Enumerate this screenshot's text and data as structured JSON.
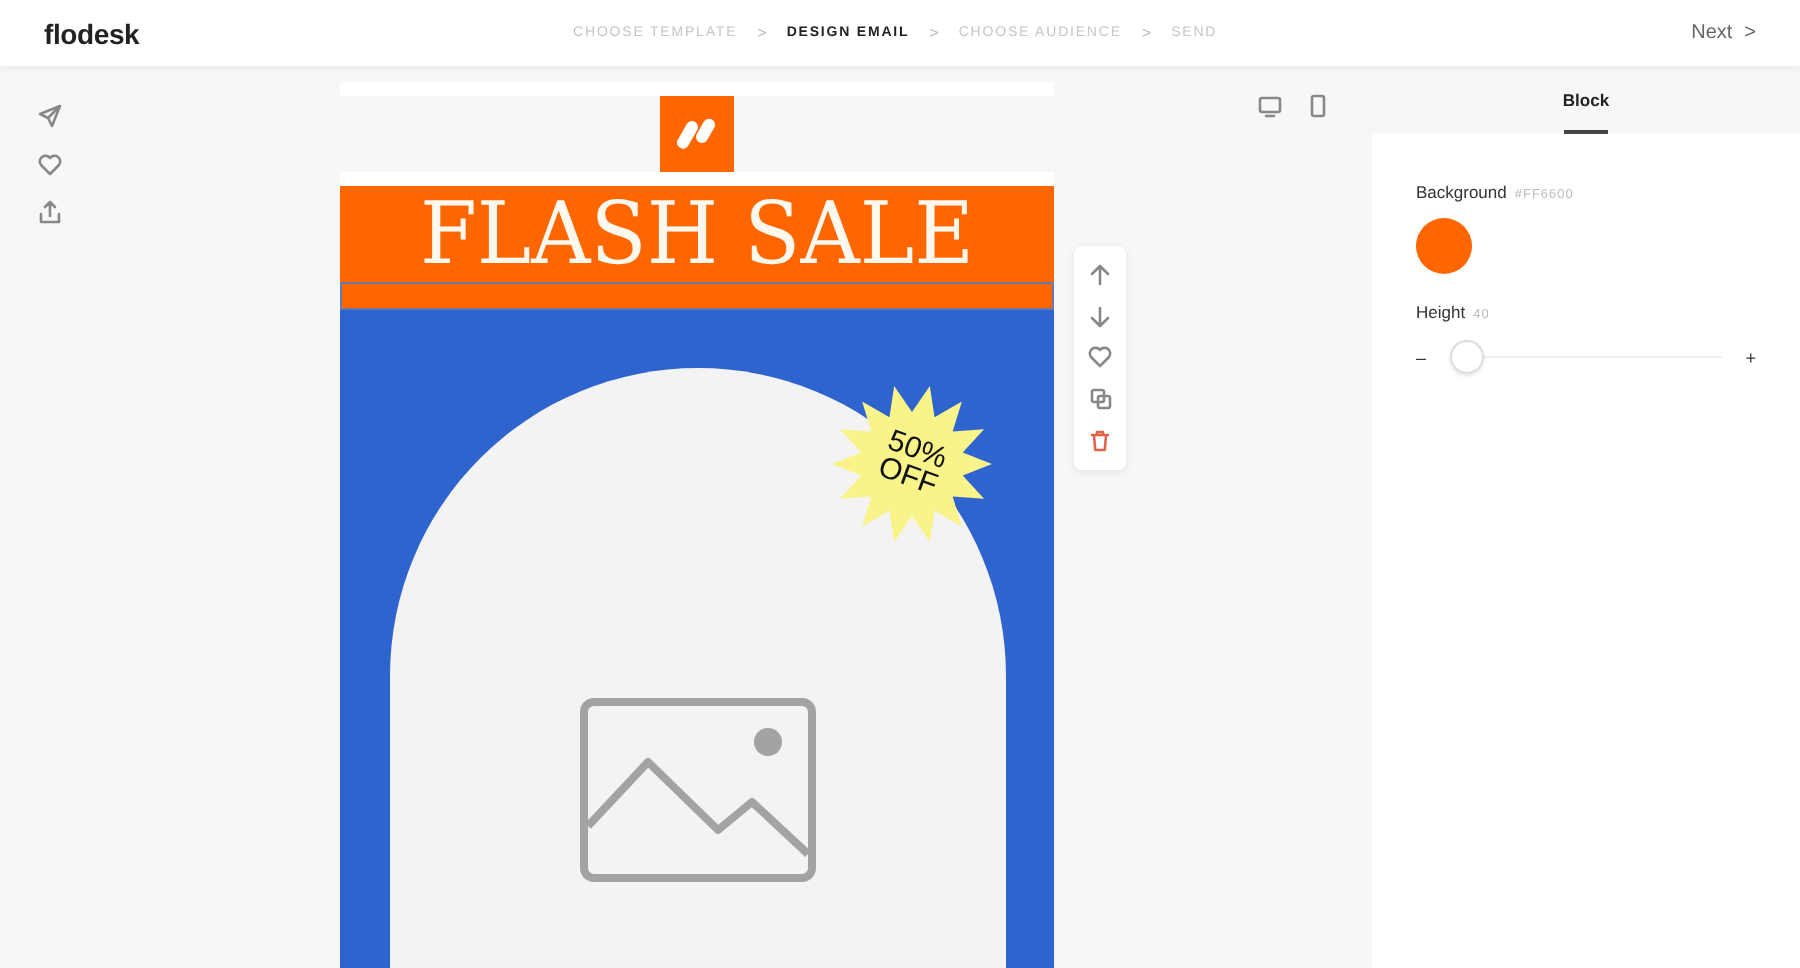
{
  "brand": "flodesk",
  "steps": [
    {
      "label": "CHOOSE TEMPLATE",
      "selected": false
    },
    {
      "label": "DESIGN EMAIL",
      "selected": true
    },
    {
      "label": "CHOOSE AUDIENCE",
      "selected": false
    },
    {
      "label": "SEND",
      "selected": false
    }
  ],
  "step_separator": ">",
  "next": {
    "label": "Next",
    "arrow": ">"
  },
  "email": {
    "headline": "FLASH SALE",
    "burst": [
      "50%",
      "OFF"
    ],
    "selected_block": {
      "selected": true
    }
  },
  "panel": {
    "tab": "Block",
    "background": {
      "label": "Background",
      "value": "#FF6600",
      "color": "#ff6600"
    },
    "height": {
      "label": "Height",
      "value": "40",
      "minus": "–",
      "plus": "+",
      "level": 0.06
    }
  }
}
